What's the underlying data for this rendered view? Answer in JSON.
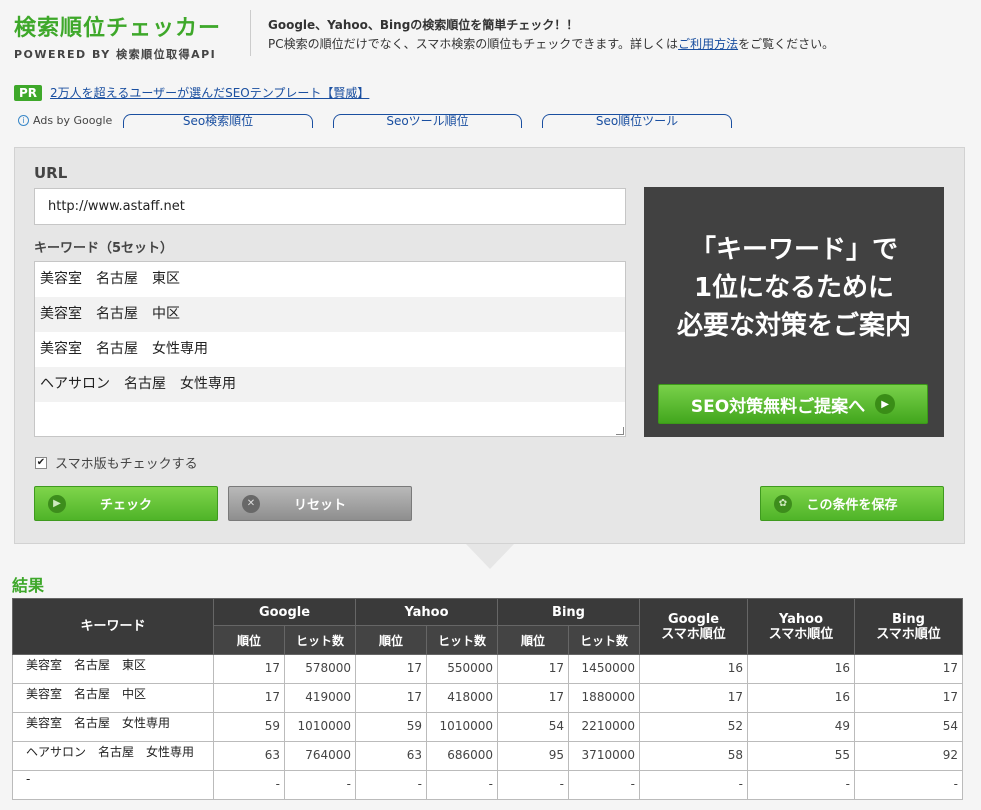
{
  "header": {
    "logo_title": "検索順位チェッカー",
    "logo_sub": "POWERED BY 検索順位取得API",
    "desc_line1": "Google、Yahoo、Bingの検索順位を簡単チェック！！",
    "desc_line2_pre": "PC検索の順位だけでなく、スマホ検索の順位もチェックできます。詳しくは",
    "desc_line2_link": "ご利用方法",
    "desc_line2_post": "をご覧ください。"
  },
  "pr": {
    "badge": "PR",
    "link": "2万人を超えるユーザーが選んだSEOテンプレート【賢威】"
  },
  "ads": {
    "label": "Ads by Google",
    "links": [
      "Seo検索順位",
      "Seoツール順位",
      "Seo順位ツール"
    ]
  },
  "form": {
    "url_label": "URL",
    "url_value": "http://www.astaff.net",
    "keyword_label": "キーワード（5セット）",
    "keywords": [
      "美容室　名古屋　東区",
      "美容室　名古屋　中区",
      "美容室　名古屋　女性専用",
      "ヘアサロン　名古屋　女性専用",
      ""
    ],
    "mobile_check_label": "スマホ版もチェックする",
    "mobile_checked": true,
    "check_button": "チェック",
    "reset_button": "リセット",
    "save_button": "この条件を保存"
  },
  "promo": {
    "line1": "「キーワード」で",
    "line2": "1位になるために",
    "line3": "必要な対策をご案内",
    "button": "SEO対策無料ご提案へ"
  },
  "results": {
    "title": "結果",
    "headers": {
      "keyword": "キーワード",
      "google": "Google",
      "yahoo": "Yahoo",
      "bing": "Bing",
      "rank": "順位",
      "hits": "ヒット数",
      "google_sp_1": "Google",
      "google_sp_2": "スマホ順位",
      "yahoo_sp_1": "Yahoo",
      "yahoo_sp_2": "スマホ順位",
      "bing_sp_1": "Bing",
      "bing_sp_2": "スマホ順位"
    },
    "rows": [
      {
        "kw": "美容室　名古屋　東区",
        "g_rank": "17",
        "g_hits": "578000",
        "y_rank": "17",
        "y_hits": "550000",
        "b_rank": "17",
        "b_hits": "1450000",
        "g_sp": "16",
        "y_sp": "16",
        "b_sp": "17"
      },
      {
        "kw": "美容室　名古屋　中区",
        "g_rank": "17",
        "g_hits": "419000",
        "y_rank": "17",
        "y_hits": "418000",
        "b_rank": "17",
        "b_hits": "1880000",
        "g_sp": "17",
        "y_sp": "16",
        "b_sp": "17"
      },
      {
        "kw": "美容室　名古屋　女性専用",
        "g_rank": "59",
        "g_hits": "1010000",
        "y_rank": "59",
        "y_hits": "1010000",
        "b_rank": "54",
        "b_hits": "2210000",
        "g_sp": "52",
        "y_sp": "49",
        "b_sp": "54"
      },
      {
        "kw": "ヘアサロン　名古屋　女性専用",
        "g_rank": "63",
        "g_hits": "764000",
        "y_rank": "63",
        "y_hits": "686000",
        "b_rank": "95",
        "b_hits": "3710000",
        "g_sp": "58",
        "y_sp": "55",
        "b_sp": "92"
      },
      {
        "kw": "-",
        "g_rank": "-",
        "g_hits": "-",
        "y_rank": "-",
        "y_hits": "-",
        "b_rank": "-",
        "b_hits": "-",
        "g_sp": "-",
        "y_sp": "-",
        "b_sp": "-"
      }
    ]
  }
}
